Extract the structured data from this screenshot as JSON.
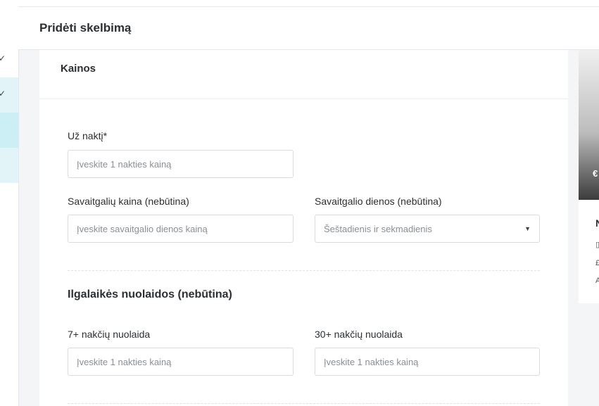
{
  "header": {
    "title": "Pridėti skelbimą"
  },
  "sidebar": {
    "items": [
      {
        "check": "✓"
      },
      {
        "check": "✓"
      },
      {
        "check": ""
      },
      {
        "check": ""
      }
    ]
  },
  "card": {
    "title": "Kainos",
    "per_night": {
      "label": "Už naktį*",
      "placeholder": "Įveskite 1 nakties kainą"
    },
    "weekend_price": {
      "label": "Savaitgalių kaina (nebūtina)",
      "placeholder": "Įveskite savaitgalio dienos kainą"
    },
    "weekend_days": {
      "label": "Savaitgalio dienos (nebūtina)",
      "value": "Šeštadienis ir sekmadienis"
    },
    "discounts": {
      "title": "Ilgalaikės nuolaidos (nebūtina)",
      "week": {
        "label": "7+ nakčių nuolaida",
        "placeholder": "Įveskite 1 nakties kainą"
      },
      "month": {
        "label": "30+ nakčių nuolaida",
        "placeholder": "Įveskite 1 nakties kainą"
      }
    }
  },
  "preview": {
    "price_symbol": "€",
    "letter": "N",
    "glyphs": [
      "▯",
      "£",
      "A"
    ]
  }
}
